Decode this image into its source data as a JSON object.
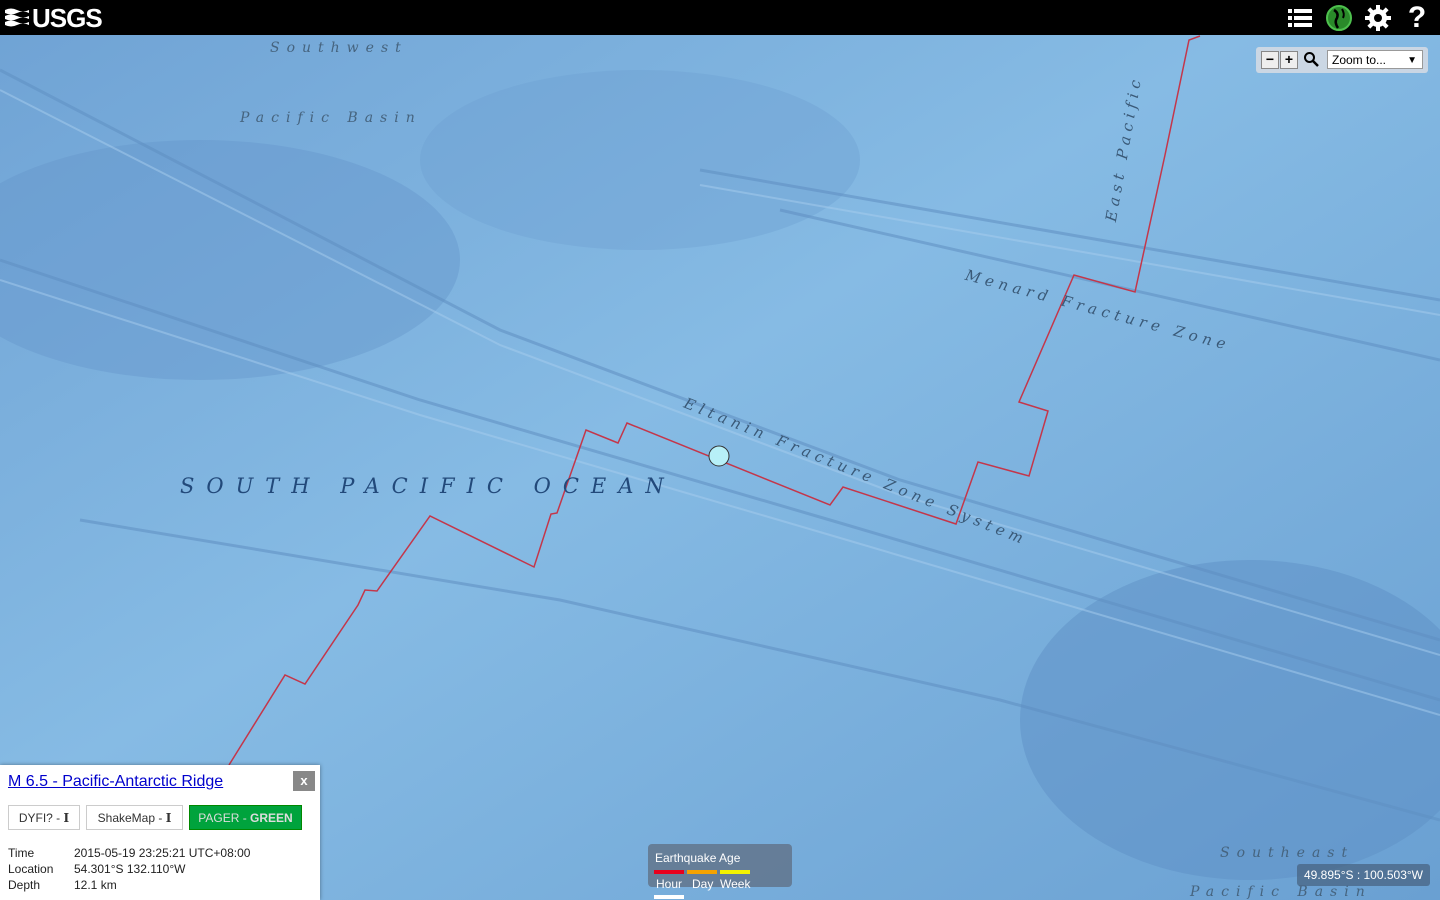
{
  "header": {
    "logo_text": "USGS",
    "icons": [
      "list-icon",
      "globe-icon",
      "gear-icon",
      "help-icon"
    ],
    "help_glyph": "?"
  },
  "zoom": {
    "out_label": "−",
    "in_label": "+",
    "select_value": "Zoom to..."
  },
  "map_labels": {
    "sw_basin_1": "Southwest",
    "sw_basin_2": "Pacific Basin",
    "ocean": "SOUTH PACIFIC OCEAN",
    "east_pacific": "East Pacific",
    "menard": "Menard Fracture Zone",
    "eltanin": "Eltanin Fracture Zone System",
    "se_basin_1": "Southeast",
    "se_basin_2": "Pacific Basin"
  },
  "popup": {
    "title": "M 6.5 - Pacific-Antarctic Ridge",
    "close_label": "x",
    "dyfi_label": "DYFI? - ",
    "dyfi_value": "I",
    "shakemap_label": "ShakeMap - ",
    "shakemap_value": "I",
    "pager_label": "PAGER - ",
    "pager_value": "GREEN",
    "rows": [
      {
        "key": "Time",
        "value": "2015-05-19 23:25:21 UTC+08:00"
      },
      {
        "key": "Location",
        "value": "54.301°S 132.110°W"
      },
      {
        "key": "Depth",
        "value": "12.1 km"
      }
    ]
  },
  "legend": {
    "title": "Earthquake Age",
    "hour": "Hour",
    "day": "Day",
    "week": "Week",
    "colors": {
      "hour": "#e8001c",
      "day": "#f5a200",
      "week": "#f2f200"
    }
  },
  "coords": "49.895°S : 100.503°W",
  "colors": {
    "plate_boundary": "#c4364a",
    "event_marker": "#b7f0f7",
    "ocean": "#7ab0de"
  }
}
